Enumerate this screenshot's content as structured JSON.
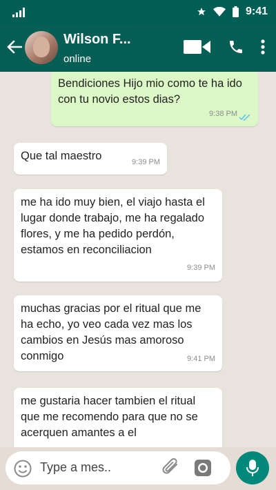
{
  "status_bar": {
    "time": "9:41"
  },
  "header": {
    "contact_name": "Wilson F...",
    "presence": "online"
  },
  "messages": [
    {
      "direction": "out",
      "text": "Bendiciones Hijo mio como te ha ido con tu novio estos dias?",
      "time": "9:38 PM",
      "read": true
    },
    {
      "direction": "in",
      "text": "Que tal maestro",
      "time": "9:39 PM"
    },
    {
      "direction": "in",
      "text": "me ha ido muy bien, el viajo hasta el lugar donde trabajo, me ha regalado flores, y me ha pedido perdón, estamos en reconciliacion",
      "time": "9:39 PM"
    },
    {
      "direction": "in",
      "text": "muchas gracias por el ritual que me ha echo, yo veo cada vez mas los cambios en Jesús mas amoroso conmigo",
      "time": "9:41 PM"
    },
    {
      "direction": "in",
      "text": "me gustaria hacer tambien el ritual que me recomendo para que no se acerquen amantes a el",
      "time": ""
    }
  ],
  "composer": {
    "placeholder": "Type a mes.."
  },
  "colors": {
    "header": "#075e54",
    "status_bar": "#005e54",
    "outgoing_bubble": "#dcf8c6",
    "mic_button": "#00897b",
    "read_ticks": "#4fc3f7"
  }
}
